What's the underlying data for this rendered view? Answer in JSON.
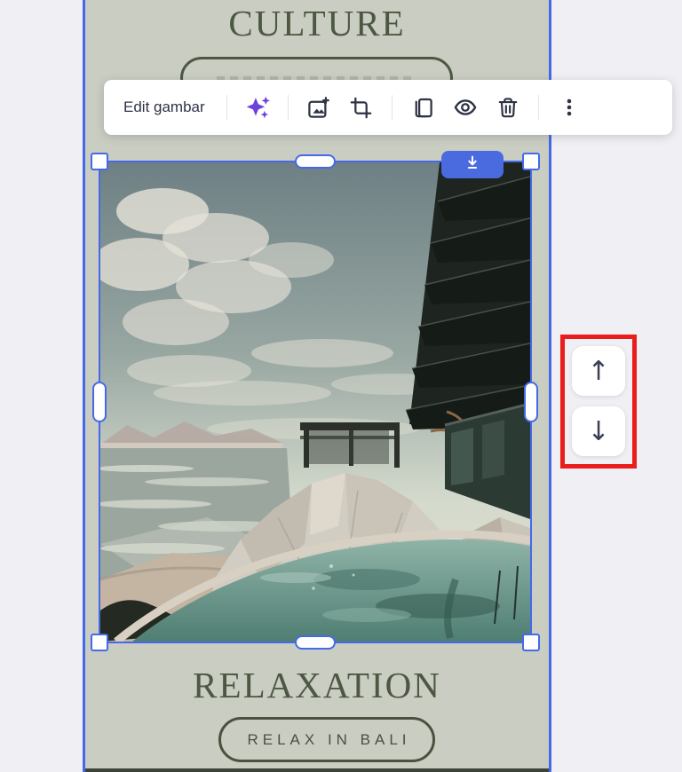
{
  "colors": {
    "workspace_background": "#f0f0f4",
    "canvas_background": "#c9cdc2",
    "selection_blue": "#4569ea",
    "download_button_blue": "#4a6adf",
    "olive_text": "#4d5843",
    "highlight_red": "#ea1c1c",
    "magic_purple": "#6c44db",
    "toolbar_icon": "#2e3345"
  },
  "canvas": {
    "section_top_title": "CULTURE",
    "section_bottom_title": "RELAXATION",
    "bottom_button_label": "RELAX IN BALI"
  },
  "toolbar": {
    "edit_button_label": "Edit gambar",
    "icon_names": [
      "magic-edit",
      "replace-image",
      "crop",
      "duplicate",
      "preview",
      "delete",
      "more-options"
    ]
  },
  "reorder_controls": {
    "up_glyph": "↑",
    "down_glyph": "↓"
  }
}
